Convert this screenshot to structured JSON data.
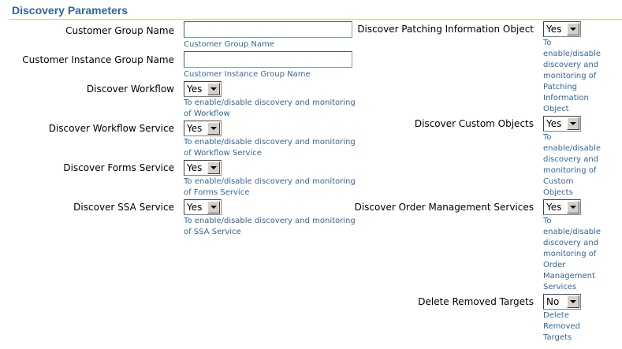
{
  "section": {
    "title": "Discovery Parameters"
  },
  "left": {
    "customer_group_name": {
      "label": "Customer Group Name",
      "value": "",
      "hint": "Customer Group Name"
    },
    "customer_instance_group_name": {
      "label": "Customer Instance Group Name",
      "value": "",
      "hint": "Customer Instance Group Name"
    },
    "discover_workflow": {
      "label": "Discover Workflow",
      "value": "Yes",
      "hint_line1": "To enable/disable discovery and monitoring",
      "hint_line2": "of Workflow"
    },
    "discover_workflow_service": {
      "label": "Discover Workflow Service",
      "value": "Yes",
      "hint_line1": "To enable/disable discovery and monitoring",
      "hint_line2": "of Workflow Service"
    },
    "discover_forms_service": {
      "label": "Discover Forms Service",
      "value": "Yes",
      "hint_line1": "To enable/disable discovery and monitoring",
      "hint_line2": "of Forms Service"
    },
    "discover_ssa_service": {
      "label": "Discover SSA Service",
      "value": "Yes",
      "hint_line1": "To enable/disable discovery and monitoring",
      "hint_line2": "of SSA Service"
    }
  },
  "right": {
    "discover_patching": {
      "label": "Discover Patching Information Object",
      "value": "Yes",
      "hint": [
        "To",
        "enable/disable",
        "discovery and",
        "monitoring of",
        "Patching",
        "Information",
        "Object"
      ]
    },
    "discover_custom_objects": {
      "label": "Discover Custom Objects",
      "value": "Yes",
      "hint": [
        "To",
        "enable/disable",
        "discovery and",
        "monitoring of",
        "Custom",
        "Objects"
      ]
    },
    "discover_order_mgmt": {
      "label": "Discover Order Management Services",
      "value": "Yes",
      "hint": [
        "To",
        "enable/disable",
        "discovery and",
        "monitoring of",
        "Order",
        "Management",
        "Services"
      ]
    },
    "delete_removed_targets": {
      "label": "Delete Removed Targets",
      "value": "No",
      "hint": [
        "Delete",
        "Removed",
        "Targets"
      ]
    }
  }
}
